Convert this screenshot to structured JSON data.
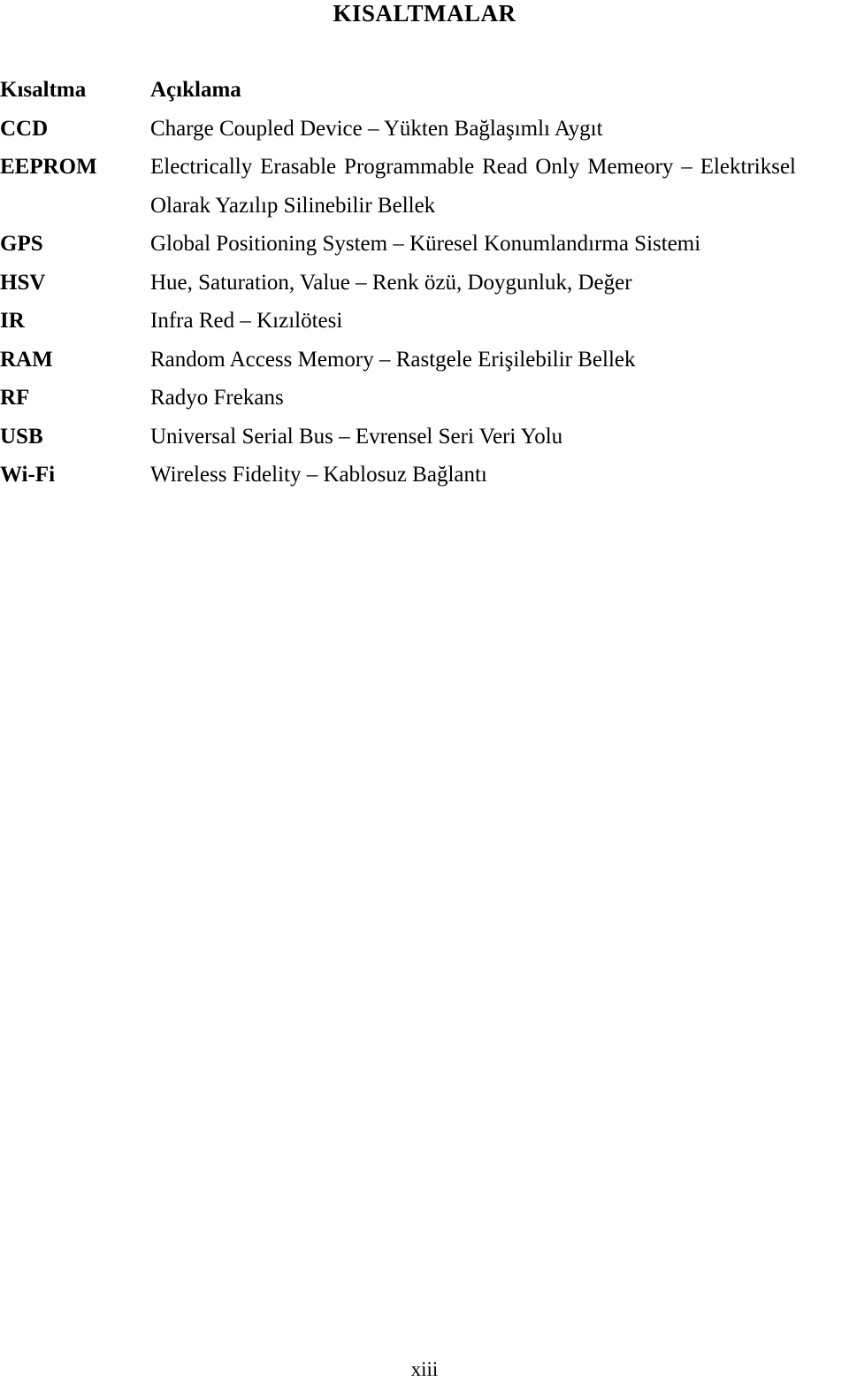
{
  "document": {
    "title": "KISALTMALAR",
    "page_number": "xiii"
  },
  "table": {
    "headers": {
      "abbreviation": "Kısaltma",
      "description": "Açıklama"
    },
    "rows": [
      {
        "abbr": "CCD",
        "desc": "Charge Coupled Device – Yükten Bağlaşımlı Aygıt"
      },
      {
        "abbr": "EEPROM",
        "desc": "Electrically Erasable Programmable Read Only Memeory – Elektriksel Olarak Yazılıp Silinebilir Bellek"
      },
      {
        "abbr": "GPS",
        "desc": "Global Positioning System – Küresel Konumlandırma Sistemi"
      },
      {
        "abbr": "HSV",
        "desc": "Hue, Saturation, Value – Renk özü, Doygunluk, Değer"
      },
      {
        "abbr": "IR",
        "desc": "Infra Red – Kızılötesi"
      },
      {
        "abbr": "RAM",
        "desc": "Random Access Memory – Rastgele Erişilebilir Bellek"
      },
      {
        "abbr": "RF",
        "desc": "Radyo Frekans"
      },
      {
        "abbr": "USB",
        "desc": "Universal Serial Bus – Evrensel Seri Veri Yolu"
      },
      {
        "abbr": "Wi-Fi",
        "desc": "Wireless Fidelity – Kablosuz Bağlantı"
      }
    ]
  }
}
